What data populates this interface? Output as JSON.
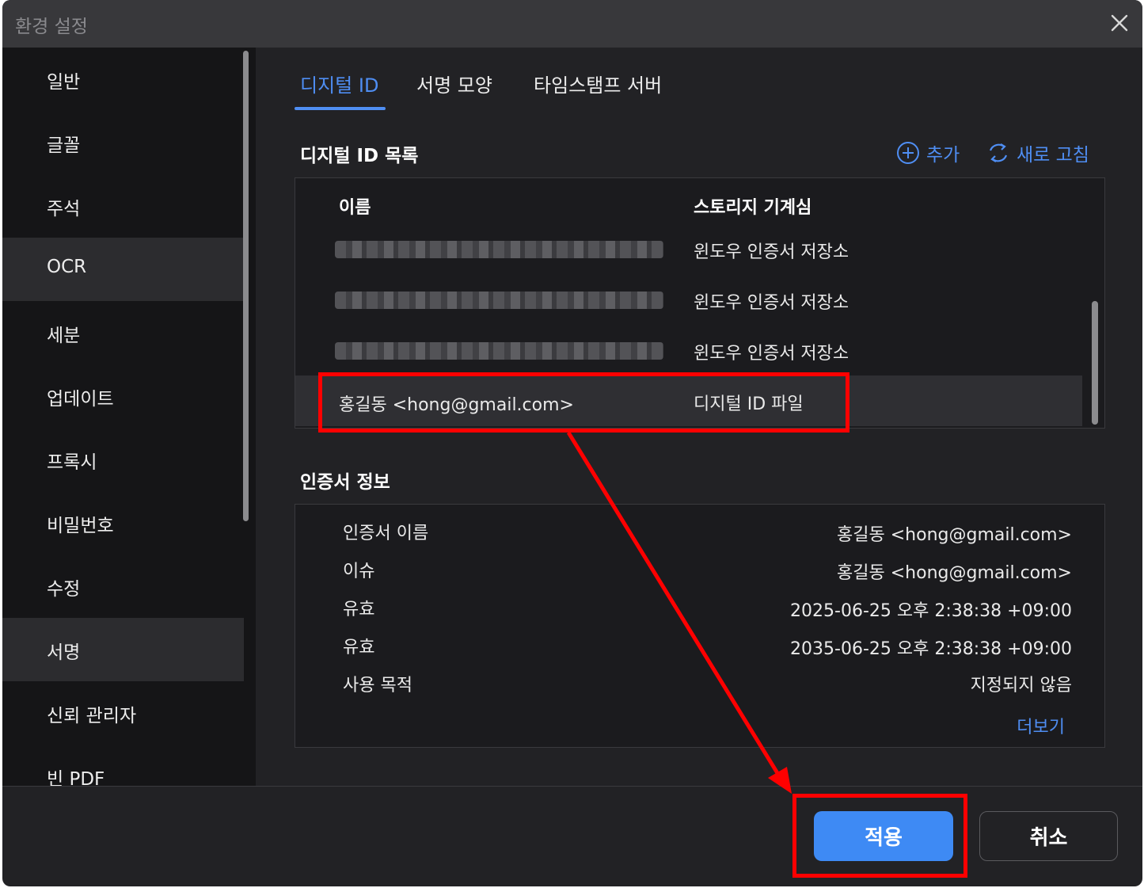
{
  "window": {
    "title": "환경 설정"
  },
  "sidebar": {
    "items": [
      {
        "label": "일반"
      },
      {
        "label": "글꼴"
      },
      {
        "label": "주석"
      },
      {
        "label": "OCR"
      },
      {
        "label": "세분"
      },
      {
        "label": "업데이트"
      },
      {
        "label": "프록시"
      },
      {
        "label": "비밀번호"
      },
      {
        "label": "수정"
      },
      {
        "label": "서명"
      },
      {
        "label": "신뢰 관리자"
      },
      {
        "label": "빈 PDF"
      }
    ]
  },
  "tabs": [
    {
      "label": "디지털 ID"
    },
    {
      "label": "서명 모양"
    },
    {
      "label": "타임스탬프 서버"
    }
  ],
  "id_list": {
    "title": "디지털 ID 목록",
    "add_label": "추가",
    "refresh_label": "새로 고침",
    "columns": {
      "name": "이름",
      "storage": "스토리지 기계심"
    },
    "rows": [
      {
        "storage": "윈도우 인증서 저장소"
      },
      {
        "storage": "윈도우 인증서 저장소"
      },
      {
        "storage": "윈도우 인증서 저장소"
      },
      {
        "name": "홍길동 <hong@gmail.com>",
        "storage": "디지털 ID 파일"
      }
    ]
  },
  "cert_info": {
    "title": "인증서 정보",
    "rows": [
      {
        "label": "인증서 이름",
        "value": "홍길동 <hong@gmail.com>"
      },
      {
        "label": "이슈",
        "value": "홍길동 <hong@gmail.com>"
      },
      {
        "label": "유효",
        "value": "2025-06-25 오후 2:38:38 +09:00"
      },
      {
        "label": "유효",
        "value": "2035-06-25 오후 2:38:38 +09:00"
      },
      {
        "label": "사용 목적",
        "value": "지정되지 않음"
      }
    ],
    "more_label": "더보기"
  },
  "footer": {
    "apply_label": "적용",
    "cancel_label": "취소"
  },
  "colors": {
    "accent": "#3e8af4",
    "annotation": "#ff0000",
    "background": "#222225"
  }
}
